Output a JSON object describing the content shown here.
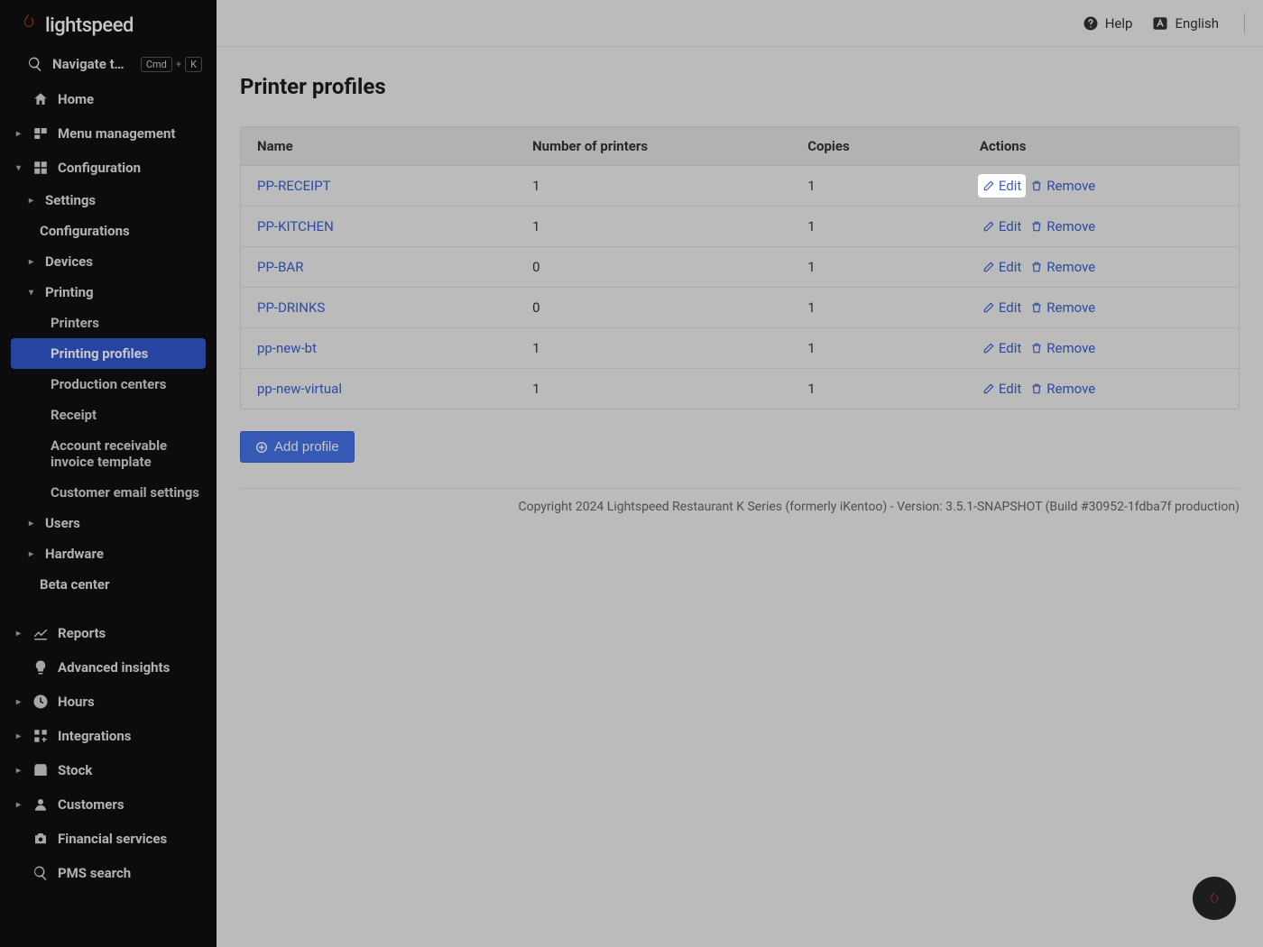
{
  "brand": "lightspeed",
  "nav": {
    "search_placeholder": "Navigate to...",
    "kbd1": "Cmd",
    "kbd_plus": "+",
    "kbd2": "K",
    "home": "Home",
    "menu_mgmt": "Menu management",
    "configuration": "Configuration",
    "settings": "Settings",
    "configurations": "Configurations",
    "devices": "Devices",
    "printing": "Printing",
    "printers": "Printers",
    "printing_profiles": "Printing profiles",
    "production_centers": "Production centers",
    "receipt": "Receipt",
    "ar_invoice": "Account receivable invoice template",
    "customer_email": "Customer email settings",
    "users": "Users",
    "hardware": "Hardware",
    "beta_center": "Beta center",
    "reports": "Reports",
    "adv_insights": "Advanced insights",
    "hours": "Hours",
    "integrations": "Integrations",
    "stock": "Stock",
    "customers": "Customers",
    "financial": "Financial services",
    "pms_search": "PMS search"
  },
  "topbar": {
    "help": "Help",
    "language": "English"
  },
  "page": {
    "title": "Printer profiles",
    "table": {
      "headers": {
        "name": "Name",
        "printers": "Number of printers",
        "copies": "Copies",
        "actions": "Actions"
      },
      "edit_label": "Edit",
      "remove_label": "Remove",
      "rows": [
        {
          "name": "PP-RECEIPT",
          "printers": "1",
          "copies": "1"
        },
        {
          "name": "PP-KITCHEN",
          "printers": "1",
          "copies": "1"
        },
        {
          "name": "PP-BAR",
          "printers": "0",
          "copies": "1"
        },
        {
          "name": "PP-DRINKS",
          "printers": "0",
          "copies": "1"
        },
        {
          "name": "pp-new-bt",
          "printers": "1",
          "copies": "1"
        },
        {
          "name": "pp-new-virtual",
          "printers": "1",
          "copies": "1"
        }
      ]
    },
    "add_profile": "Add profile"
  },
  "footer": "Copyright 2024 Lightspeed Restaurant K Series (formerly iKentoo) - Version: 3.5.1-SNAPSHOT (Build #30952-1fdba7f production)"
}
